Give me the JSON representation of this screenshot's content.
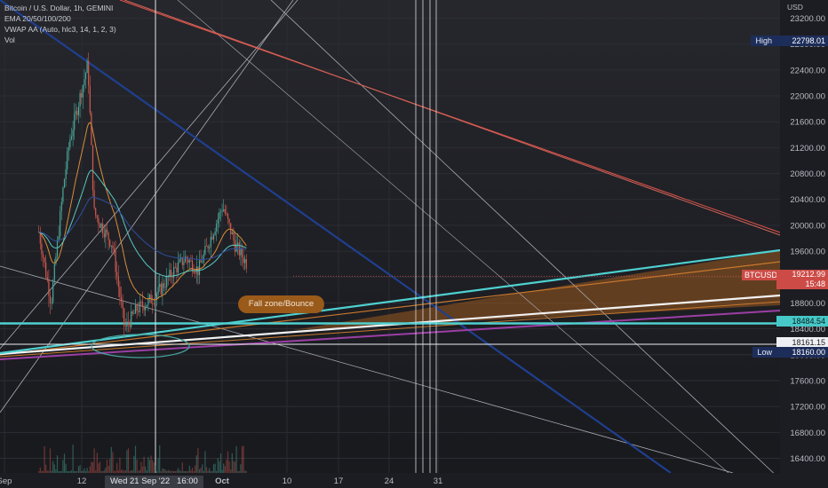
{
  "legend": {
    "symbol": "Bitcoin / U.S. Dollar, 1h, GEMINI",
    "ema": "EMA 20/50/100/200",
    "vwap": "VWAP AA (Auto, hlc3, 14, 1, 2, 3)",
    "vol": "Vol"
  },
  "axis_unit": "USD",
  "badges": {
    "high": {
      "label": "High",
      "value": "22798.01"
    },
    "btc": {
      "label": "BTCUSD",
      "value": "19212.99",
      "timer": "15:48"
    },
    "level1": {
      "value": "18484.54"
    },
    "level2": {
      "value": "18161.15"
    },
    "low": {
      "label": "Low",
      "value": "18160.00"
    }
  },
  "crosshair_label": "Wed 21 Sep '22   16:00",
  "annotation": "Fall zone/Bounce",
  "colors": {
    "cyan": "#4fd0d0",
    "red": "#e0534a",
    "blue": "#1f3f8f",
    "white": "#f2f2f2",
    "purple": "#9b3fa5",
    "orange": "#c8782c",
    "candle_up": "#4aa89a",
    "candle_down": "#d25a4f"
  },
  "chart_data": {
    "type": "candlestick",
    "symbol": "BTCUSD",
    "timeframe": "1h",
    "exchange": "GEMINI",
    "ylim": [
      16200,
      23350
    ],
    "y_ticks": [
      16400,
      16800,
      17200,
      17600,
      18000,
      18400,
      18800,
      19200,
      19600,
      20000,
      20400,
      20800,
      21200,
      21600,
      22000,
      22400,
      22800,
      23200
    ],
    "x_ticks": [
      "Sep",
      "12",
      "Oct",
      "10",
      "17",
      "24",
      "31"
    ],
    "price_keypoints": [
      {
        "date": "2022-09-05",
        "price": 19900
      },
      {
        "date": "2022-09-07",
        "price": 18800
      },
      {
        "date": "2022-09-09",
        "price": 20600
      },
      {
        "date": "2022-09-10",
        "price": 21300
      },
      {
        "date": "2022-09-13",
        "price": 22500
      },
      {
        "date": "2022-09-14",
        "price": 20200
      },
      {
        "date": "2022-09-17",
        "price": 19700
      },
      {
        "date": "2022-09-19",
        "price": 18400
      },
      {
        "date": "2022-09-21",
        "price": 18700
      },
      {
        "date": "2022-09-24",
        "price": 18900
      },
      {
        "date": "2022-09-27",
        "price": 19300
      },
      {
        "date": "2022-09-29",
        "price": 19500
      },
      {
        "date": "2022-10-01",
        "price": 19300
      },
      {
        "date": "2022-10-05",
        "price": 20300
      },
      {
        "date": "2022-10-07",
        "price": 19700
      },
      {
        "date": "2022-10-09",
        "price": 19400
      }
    ],
    "high": 22798.01,
    "low": 18160.0,
    "last": 19212.99,
    "levels": [
      18484.54,
      18161.15
    ],
    "annotations": [
      "Fall zone/Bounce"
    ]
  }
}
